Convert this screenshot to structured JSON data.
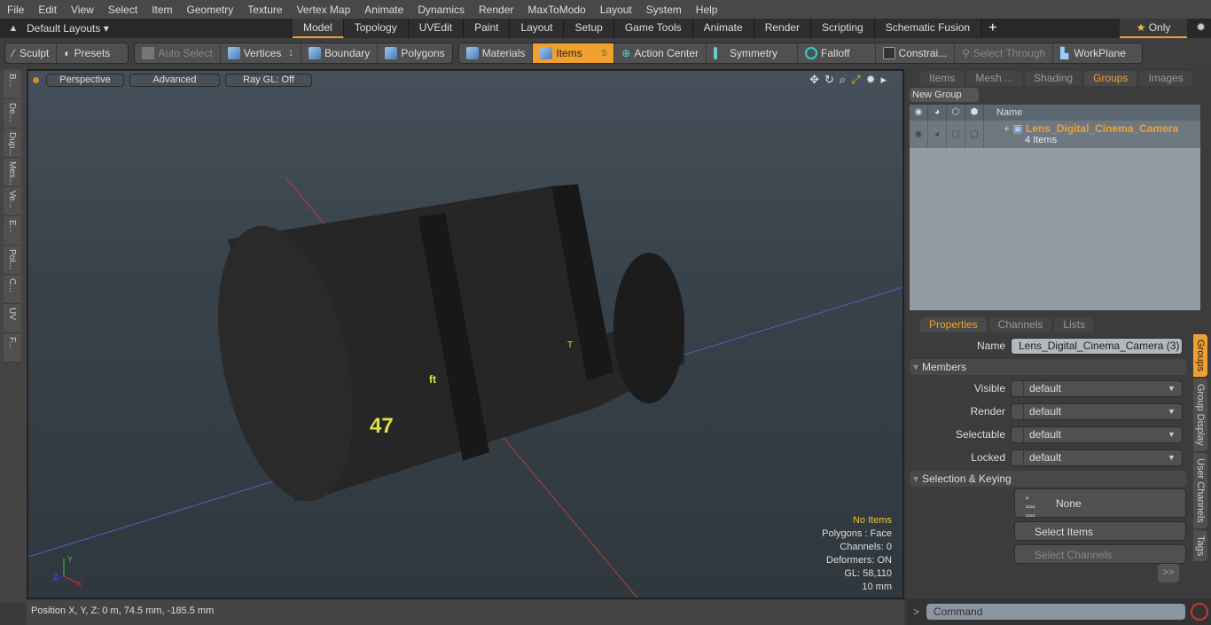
{
  "menu": [
    "File",
    "Edit",
    "View",
    "Select",
    "Item",
    "Geometry",
    "Texture",
    "Vertex Map",
    "Animate",
    "Dynamics",
    "Render",
    "MaxToModo",
    "Layout",
    "System",
    "Help"
  ],
  "layout": {
    "name": "Default Layouts ▾",
    "tabs": [
      "Model",
      "Topology",
      "UVEdit",
      "Paint",
      "Layout",
      "Setup",
      "Game Tools",
      "Animate",
      "Render",
      "Scripting",
      "Schematic Fusion"
    ],
    "active": "Model",
    "only": "Only"
  },
  "toolbar": {
    "sculpt": "Sculpt",
    "presets": "Presets",
    "auto_select": "Auto Select",
    "vertices": "Vertices",
    "vertices_count": "1",
    "boundary": "Boundary",
    "polygons": "Polygons",
    "materials": "Materials",
    "items": "Items",
    "items_count": "5",
    "action_center": "Action Center",
    "symmetry": "Symmetry",
    "falloff": "Falloff",
    "constraints": "Constrai...",
    "select_through": "Select Through",
    "workplane": "WorkPlane"
  },
  "left_tabs": [
    "B...",
    "De...",
    "Dup...",
    "Mes...",
    "Ve...",
    "E...",
    "Pol...",
    "C...",
    "UV",
    "F..."
  ],
  "viewport": {
    "view": "Perspective",
    "style": "Advanced",
    "raygl": "Ray GL: Off",
    "info": {
      "items": "No Items",
      "polygons": "Polygons : Face",
      "channels": "Channels: 0",
      "deformers": "Deformers: ON",
      "gl": "GL: 58,110",
      "unit": "10 mm"
    }
  },
  "status": {
    "position": "Position X, Y, Z:   0 m, 74.5 mm, -185.5 mm"
  },
  "groups_panel": {
    "tabs": [
      "Items",
      "Mesh ...",
      "Shading",
      "Groups",
      "Images"
    ],
    "active": "Groups",
    "new_group": "New Group",
    "name_header": "Name",
    "group_name": "Lens_Digital_Cinema_Camera",
    "group_sub": "4 Items"
  },
  "properties": {
    "tabs": [
      "Properties",
      "Channels",
      "Lists"
    ],
    "name_label": "Name",
    "name_value": "Lens_Digital_Cinema_Camera (3)",
    "members_label": "Members",
    "fields": [
      {
        "label": "Visible",
        "value": "default"
      },
      {
        "label": "Render",
        "value": "default"
      },
      {
        "label": "Selectable",
        "value": "default"
      },
      {
        "label": "Locked",
        "value": "default"
      }
    ],
    "sel_label": "Selection & Keying",
    "none": "None",
    "select_items": "Select Items",
    "select_channels": "Select Channels",
    "more": ">>",
    "side_tabs": [
      "Groups",
      "Group Display",
      "User Channels",
      "Tags"
    ]
  },
  "command": {
    "placeholder": "Command"
  }
}
